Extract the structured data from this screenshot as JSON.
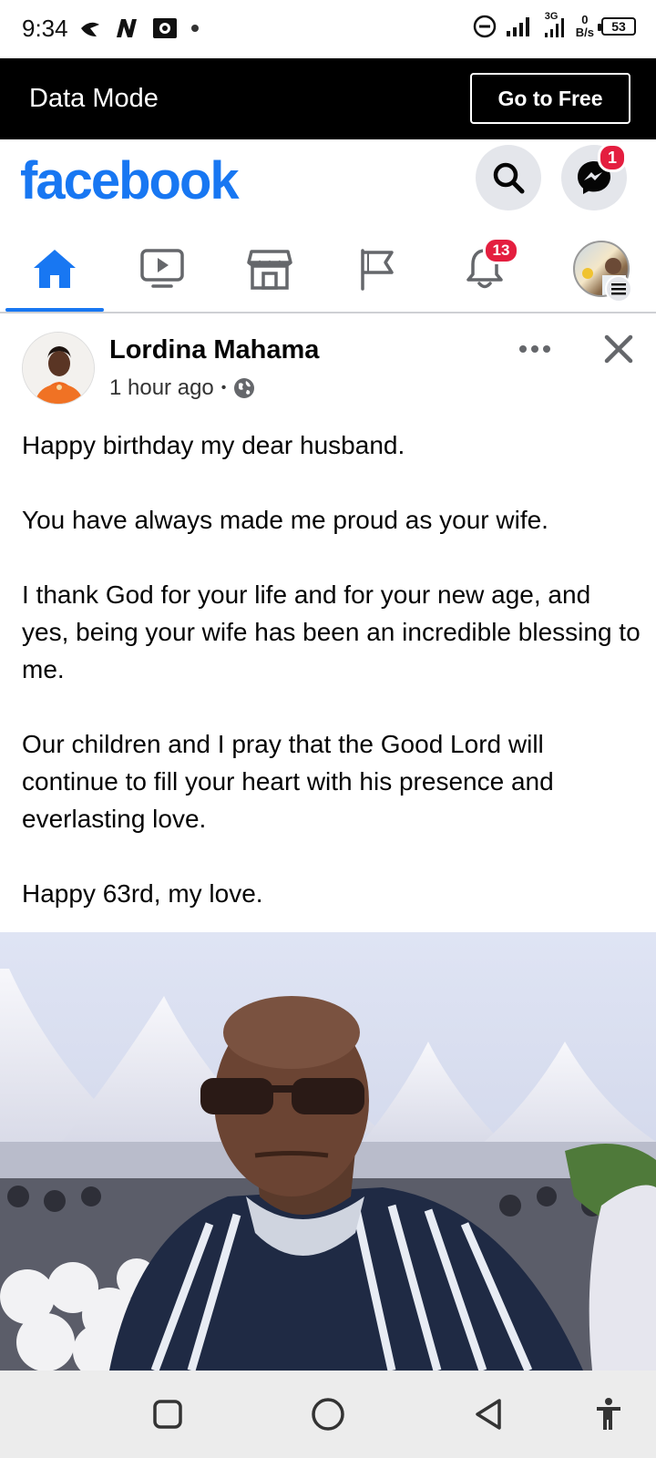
{
  "status_bar": {
    "time": "9:34",
    "net_speed_value": "0",
    "net_speed_unit": "B/s",
    "network_type": "3G",
    "battery": "53",
    "icons": [
      "wifi-assist-icon",
      "n-icon",
      "photo-notify-icon",
      "dot-icon",
      "dnd-icon",
      "signal-icon",
      "signal-icon-2",
      "battery-icon"
    ]
  },
  "data_mode": {
    "label": "Data Mode",
    "button_label": "Go to Free"
  },
  "header": {
    "logo": "facebook",
    "messenger_badge": "1",
    "icons": [
      "search-icon",
      "messenger-icon"
    ]
  },
  "nav_tabs": {
    "items": [
      "home",
      "watch",
      "marketplace",
      "pages",
      "notifications",
      "menu"
    ],
    "active": "home",
    "notifications_badge": "13"
  },
  "post": {
    "author": "Lordina Mahama",
    "time": "1 hour ago",
    "separator": "•",
    "privacy_icon": "globe-icon",
    "paragraphs": [
      "Happy birthday my dear husband.",
      "You have always made me proud as your wife.",
      "I thank God for your life and for your new age, and yes, being your wife has been an incredible blessing to me.",
      "Our children and I pray that the Good Lord will continue to fill your heart with his presence and everlasting love.",
      "Happy 63rd, my love."
    ]
  },
  "colors": {
    "brand": "#1877f2",
    "badge": "#e41e3f",
    "banner_bg": "#000000",
    "nav_bg": "#ececec"
  }
}
